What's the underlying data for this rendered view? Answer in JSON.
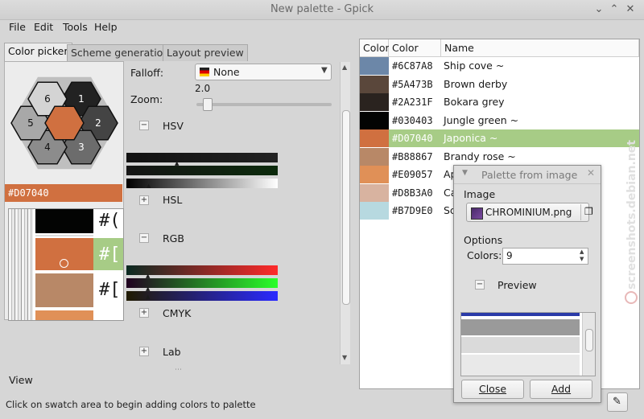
{
  "window": {
    "title": "New palette - Gpick"
  },
  "menu": [
    "File",
    "Edit",
    "Tools",
    "Help"
  ],
  "tabs": [
    "Color picker",
    "Scheme generation",
    "Layout preview"
  ],
  "hexagons": [
    {
      "label": "1",
      "color": "#222222"
    },
    {
      "label": "2",
      "color": "#444444"
    },
    {
      "label": "3",
      "color": "#6c6c6c"
    },
    {
      "label": "4",
      "color": "#8c8c8c"
    },
    {
      "label": "5",
      "color": "#a8a8a8"
    },
    {
      "label": "6",
      "color": "#d4d4d4"
    },
    {
      "label": "",
      "color": "#D07040"
    }
  ],
  "current_color": "#D07040",
  "zoom_preview": {
    "texts": [
      "#(",
      "#[",
      "#["
    ]
  },
  "settings": {
    "falloff_label": "Falloff:",
    "falloff_value": "None",
    "zoom_label": "Zoom:",
    "zoom_value": "2.0",
    "zoom_level": 0.05,
    "sections": [
      "HSV",
      "HSL",
      "RGB",
      "CMYK",
      "Lab"
    ]
  },
  "palette": {
    "headers": [
      "Color",
      "Color",
      "Name"
    ],
    "rows": [
      {
        "hex": "#6C87A8",
        "name": "Ship cove ~",
        "selected": false
      },
      {
        "hex": "#5A473B",
        "name": "Brown derby",
        "selected": false
      },
      {
        "hex": "#2A231F",
        "name": "Bokara grey",
        "selected": false
      },
      {
        "hex": "#030403",
        "name": "Jungle green ~",
        "selected": false
      },
      {
        "hex": "#D07040",
        "name": "Japonica ~",
        "selected": true
      },
      {
        "hex": "#B88867",
        "name": "Brandy rose ~",
        "selected": false
      },
      {
        "hex": "#E09057",
        "name": "Ap",
        "selected": false
      },
      {
        "hex": "#D8B3A0",
        "name": "Ca",
        "selected": false
      },
      {
        "hex": "#B7D9E0",
        "name": "Sc",
        "selected": false
      }
    ]
  },
  "dialog": {
    "title": "Palette from image",
    "image_label": "Image",
    "file_name": "CHROMINIUM.png",
    "options_label": "Options",
    "colors_label": "Colors:",
    "colors_value": "9",
    "preview_label": "Preview",
    "close_label": "Close",
    "add_label": "Add"
  },
  "view_label": "View",
  "status": "Click on swatch area to begin adding colors to palette",
  "watermark": "screenshots.debian.net"
}
